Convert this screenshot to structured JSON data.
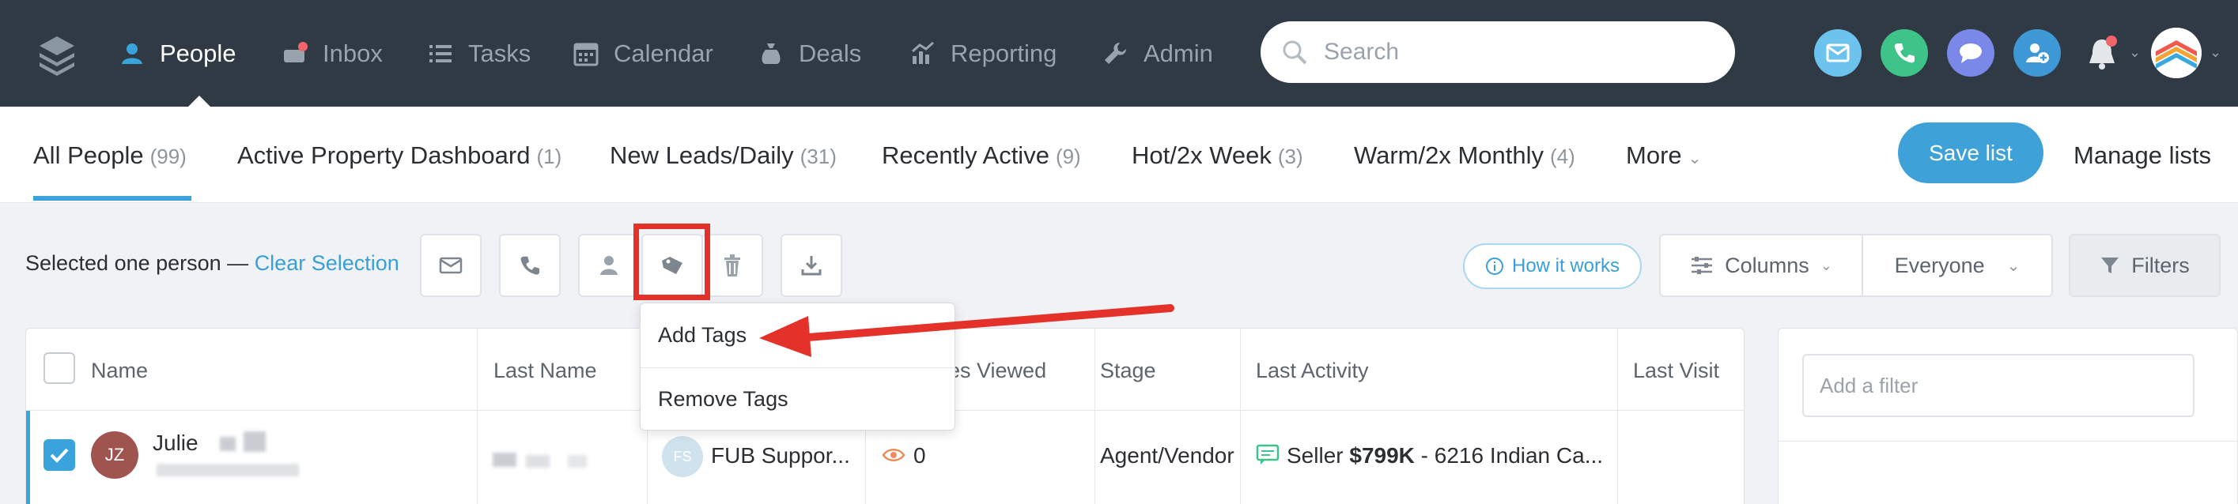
{
  "nav": {
    "items": [
      {
        "label": "People",
        "icon": "person-icon"
      },
      {
        "label": "Inbox",
        "icon": "inbox-icon"
      },
      {
        "label": "Tasks",
        "icon": "list-icon"
      },
      {
        "label": "Calendar",
        "icon": "calendar-icon"
      },
      {
        "label": "Deals",
        "icon": "money-bag-icon"
      },
      {
        "label": "Reporting",
        "icon": "chart-icon"
      },
      {
        "label": "Admin",
        "icon": "wrench-icon"
      }
    ],
    "search_placeholder": "Search"
  },
  "tabs": [
    {
      "label": "All People",
      "count": "(99)"
    },
    {
      "label": "Active Property Dashboard",
      "count": "(1)"
    },
    {
      "label": "New Leads/Daily",
      "count": "(31)"
    },
    {
      "label": "Recently Active",
      "count": "(9)"
    },
    {
      "label": "Hot/2x Week",
      "count": "(3)"
    },
    {
      "label": "Warm/2x Monthly",
      "count": "(4)"
    },
    {
      "label": "More",
      "count": ""
    }
  ],
  "lists": {
    "save_label": "Save list",
    "manage_label": "Manage lists"
  },
  "toolbar": {
    "selected_text": "Selected one person — ",
    "clear_label": "Clear Selection",
    "how_label": "How it works",
    "columns_label": "Columns",
    "everyone_label": "Everyone",
    "filters_label": "Filters"
  },
  "dropdown": {
    "add_tags": "Add Tags",
    "remove_tags": "Remove Tags"
  },
  "table": {
    "headers": {
      "name": "Name",
      "last_name": "Last Name",
      "properties_viewed": "ies Viewed",
      "stage": "Stage",
      "last_activity": "Last Activity",
      "last_visit": "Last Visit"
    },
    "row": {
      "initials": "JZ",
      "first_name": "Julie",
      "assigned_initials": "FS",
      "assigned": "FUB Suppor...",
      "views": "0",
      "stage": "Agent/Vendor",
      "activity_prefix": "Seller",
      "activity_price": "$799K",
      "activity_rest": "- 6216 Indian Ca..."
    }
  },
  "filter_panel": {
    "placeholder": "Add a filter"
  },
  "colors": {
    "accent": "#3aa3dc",
    "topbar": "#2f3a45",
    "highlight": "#e4322b"
  }
}
